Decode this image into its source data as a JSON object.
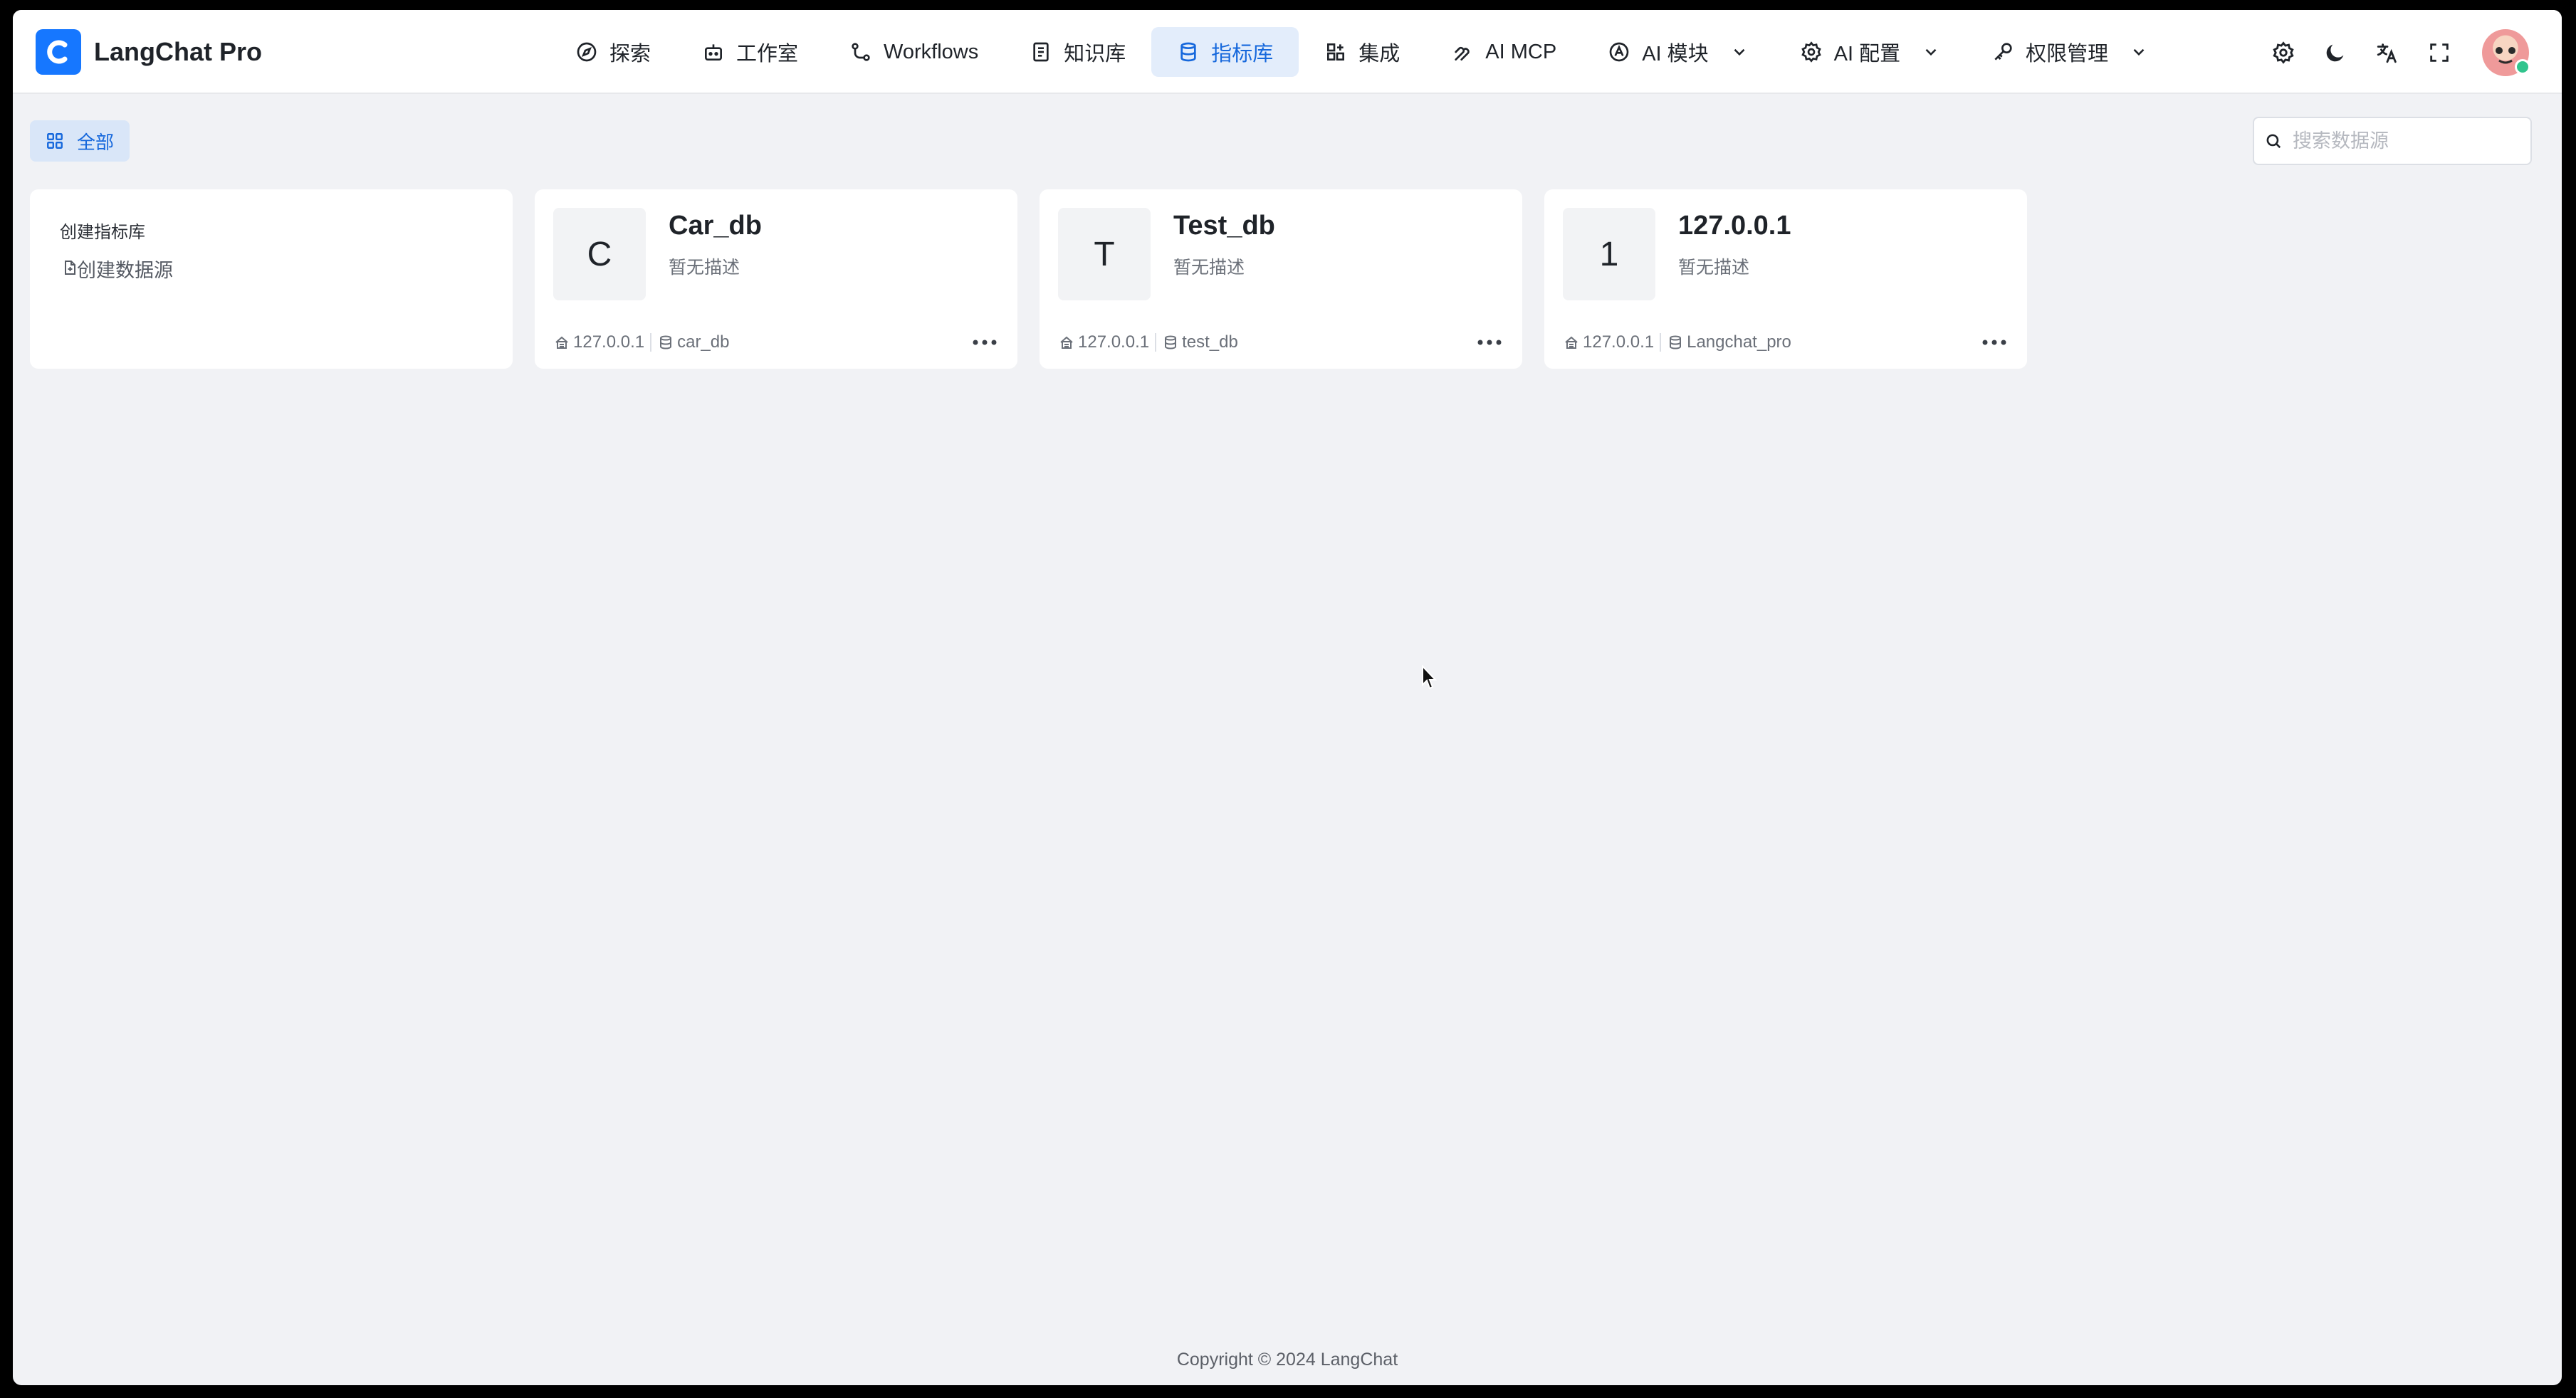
{
  "app": {
    "brand_letter": "C",
    "brand_name": "LangChat Pro"
  },
  "nav": {
    "items": [
      {
        "label": "探索",
        "icon": "compass-icon"
      },
      {
        "label": "工作室",
        "icon": "robot-icon"
      },
      {
        "label": "Workflows",
        "icon": "workflow-icon"
      },
      {
        "label": "知识库",
        "icon": "book-icon"
      },
      {
        "label": "指标库",
        "icon": "database-icon",
        "active": true
      },
      {
        "label": "集成",
        "icon": "grid-plus-icon"
      },
      {
        "label": "AI MCP",
        "icon": "mcp-icon"
      },
      {
        "label": "AI 模块",
        "icon": "module-icon",
        "dropdown": true
      },
      {
        "label": "AI 配置",
        "icon": "gear-icon",
        "dropdown": true
      },
      {
        "label": "权限管理",
        "icon": "key-icon",
        "dropdown": true
      }
    ]
  },
  "toolbar": {
    "filter_all": "全部",
    "search_placeholder": "搜索数据源"
  },
  "create_card": {
    "title": "创建指标库",
    "link": "创建数据源"
  },
  "datasources": [
    {
      "initial": "C",
      "name": "Car_db",
      "desc": "暂无描述",
      "host": "127.0.0.1",
      "db": "car_db"
    },
    {
      "initial": "T",
      "name": "Test_db",
      "desc": "暂无描述",
      "host": "127.0.0.1",
      "db": "test_db"
    },
    {
      "initial": "1",
      "name": "127.0.0.1",
      "desc": "暂无描述",
      "host": "127.0.0.1",
      "db": "Langchat_pro"
    }
  ],
  "footer": {
    "copyright": "Copyright © 2024 LangChat"
  },
  "colors": {
    "accent": "#1677ff",
    "active_bg": "#e3edfb",
    "page_bg": "#f1f2f5"
  }
}
